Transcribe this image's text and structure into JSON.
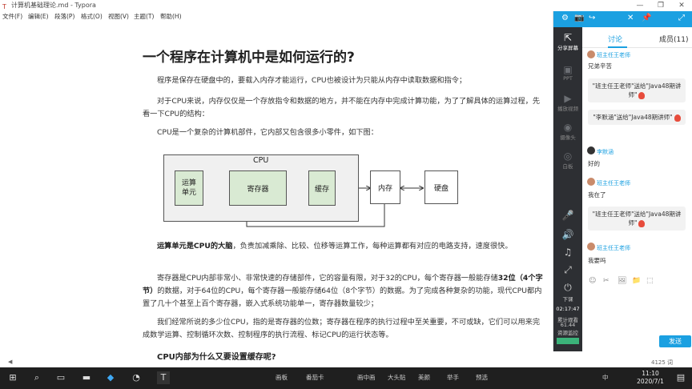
{
  "window": {
    "title": "计算机基础理论.md - Typora",
    "controls": [
      "—",
      "❐",
      "✕"
    ]
  },
  "menu": [
    "文件(F)",
    "编辑(E)",
    "段落(P)",
    "格式(O)",
    "视图(V)",
    "主题(T)",
    "帮助(H)"
  ],
  "doc": {
    "heading": "一个程序在计算机中是如何运行的?",
    "p1": "程序是保存在硬盘中的，要载入内存才能运行，CPU也被设计为只能从内存中读取数据和指令；",
    "p2": "对于CPU来说，内存仅仅是一个存放指令和数据的地方，并不能在内存中完成计算功能，为了了解具体的运算过程，先看一下CPU的结构：",
    "p3": "CPU是一个复杂的计算机部件，它内部又包含很多小零件，如下图：",
    "p4_bold": "运算单元是CPU的大脑",
    "p4_rest": "，负责加减乘除、比较、位移等运算工作，每种运算都有对应的电路支持，速度很快。",
    "p5_a": "寄存器是CPU内部非常小、非常快速的存储部件，它的容量有限，对于32的CPU，每个寄存器一般能存储",
    "p5_bold": "32位（4个字节）",
    "p5_b": "的数据，对于64位的CPU，每个寄存器一般能存储64位（8个字节）的数据。为了完成各种复杂的功能，现代CPU都内置了几十个甚至上百个寄存器，嵌入式系统功能单一，寄存器数量较少；",
    "p6": "我们经常所说的多少位CPU，指的是寄存器的位数；寄存器在程序的执行过程中至关重要，不可或缺，它们可以用来完成数学运算、控制循环次数、控制程序的执行流程、标记CPU的运行状态等。",
    "h2": "CPU内部为什么又要设置缓存呢?"
  },
  "diagram": {
    "cpu_label": "CPU",
    "alu": "运算\n单元",
    "register": "寄存器",
    "cache": "缓存",
    "memory": "内存",
    "disk": "硬盘"
  },
  "panel": {
    "top_icons": [
      "⚙",
      "📷",
      "↪",
      "✕",
      "📌",
      "⤢"
    ],
    "side": [
      {
        "icon": "share",
        "label": "分享屏幕",
        "active": true
      },
      {
        "icon": "ppt",
        "label": "PPT",
        "active": false
      },
      {
        "icon": "video",
        "label": "播放视频",
        "active": false
      },
      {
        "icon": "camera",
        "label": "摄像头",
        "active": false
      },
      {
        "icon": "whiteboard",
        "label": "白板",
        "active": false
      }
    ],
    "tabs": {
      "discuss": "讨论",
      "members": "成员(11)"
    },
    "messages": {
      "m0_name": "班主任王老师",
      "m0_text": "兄弟辛苦",
      "gift1": "\"班主任王老师\"送给\"Java48期讲师\"",
      "gift2": "\"李默涵\"送给\"Java48期讲师\"",
      "m1_name": "李默涵",
      "m1_text": "好的",
      "m2_name": "班主任王老师",
      "m2_text": "我在了",
      "gift3": "\"班主任王老师\"送给\"Java48期讲师\"",
      "m3_name": "班主任王老师",
      "m3_text": "我要吗"
    },
    "input_tools": [
      "☺",
      "✂",
      "🖼",
      "📁",
      "⬚"
    ],
    "send": "发送",
    "bottom": {
      "mic_label": "",
      "download": "下课",
      "timer": "02:17:47",
      "stats1": "累计观看",
      "stats2": "61.44",
      "stats3": "资源监控"
    }
  },
  "status": {
    "words": "4125 词"
  },
  "taskbar": {
    "apps": [
      "画板",
      "番茄卡",
      "画中画",
      "大头贴",
      "美颜",
      "举手",
      "预选"
    ],
    "lang": "中",
    "time": "11:10",
    "date": "2020/7/1"
  }
}
